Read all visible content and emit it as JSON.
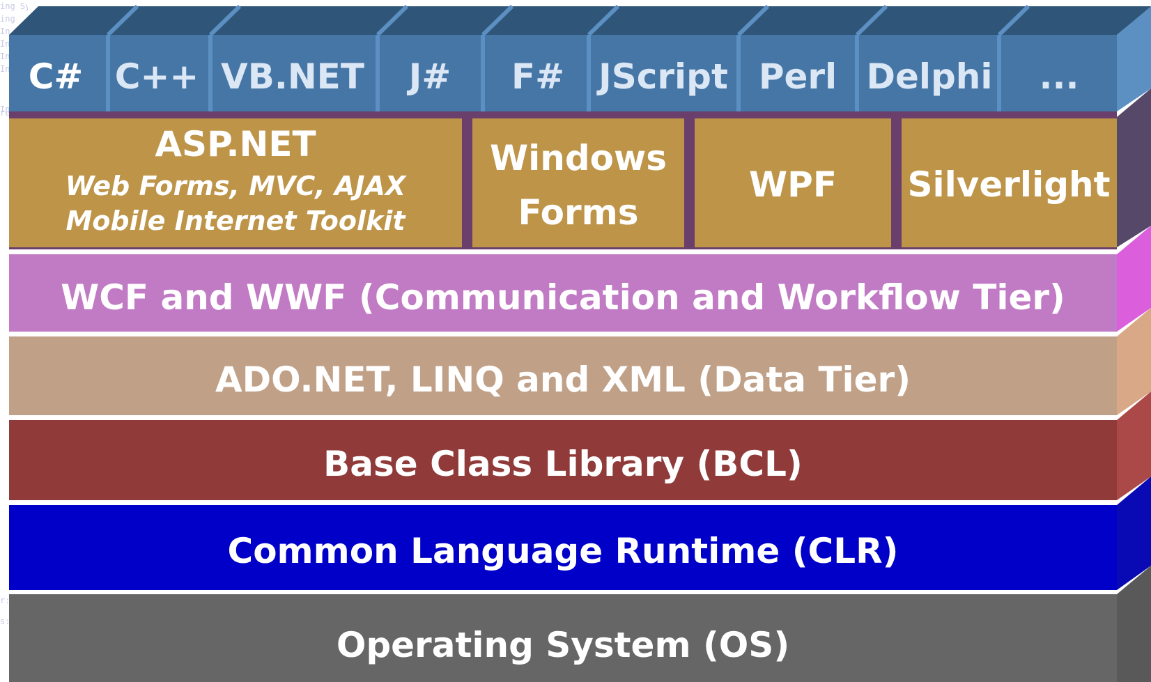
{
  "background_code": [
    "ing  System.Windows.Documents;",
    "ing",
    "In",
    "In",
    "In",
    "In",
    "In",
    "re",
    "r:",
    "s:"
  ],
  "languages": [
    "C#",
    "C++",
    "VB.NET",
    "J#",
    "F#",
    "JScript",
    "Perl",
    "Delphi",
    "..."
  ],
  "presentation": [
    {
      "title": "ASP.NET",
      "lines": [
        "Web Forms, MVC, AJAX",
        "Mobile Internet Toolkit"
      ]
    },
    {
      "title": "",
      "lines": [
        "Windows",
        "Forms"
      ]
    },
    {
      "title": "WPF",
      "lines": []
    },
    {
      "title": "Silverlight",
      "lines": []
    }
  ],
  "tiers": [
    {
      "label": "WCF and WWF (Communication and Workflow Tier)"
    },
    {
      "label": "ADO.NET, LINQ and XML (Data Tier)"
    },
    {
      "label": "Base Class Library (BCL)"
    },
    {
      "label": "Common Language Runtime (CLR)"
    },
    {
      "label": "Operating System (OS)"
    }
  ],
  "colors": {
    "language_front": "#4676a6",
    "language_top": "#2f5679",
    "language_side": "#5c8fc2",
    "presentation_front": "#bd9448",
    "presentation_side": "#564868",
    "wcf_front": "#c17ac4",
    "wcf_side": "#db5fdc",
    "ado_front": "#c0a188",
    "ado_side": "#d9a987",
    "bcl_front": "#903a3a",
    "bcl_side": "#ab4848",
    "clr_front": "#0000c8",
    "clr_side": "#0a0ab4",
    "os_front": "#666666",
    "os_side": "#595959"
  }
}
